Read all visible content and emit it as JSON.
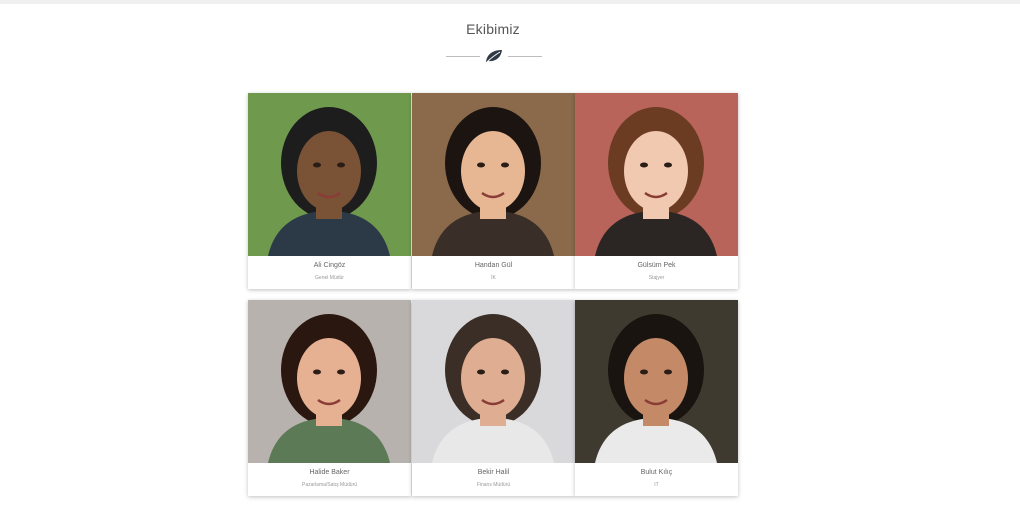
{
  "section": {
    "title": "Ekibimiz"
  },
  "icons": {
    "divider_icon": "leaf-icon"
  },
  "team": [
    {
      "name": "Ali Cingöz",
      "role": "Genel Müdür",
      "bg": "#6f9a4e",
      "skin": "#7a5236",
      "hair": "#1d1d1d",
      "shirt": "#2c3a48"
    },
    {
      "name": "Handan Gül",
      "role": "İK",
      "bg": "#8b6a4b",
      "skin": "#e7b794",
      "hair": "#1c1410",
      "shirt": "#3a2e28"
    },
    {
      "name": "Gülsüm Pek",
      "role": "Stajyer",
      "bg": "#b8645a",
      "skin": "#f1c8b0",
      "hair": "#6b3c22",
      "shirt": "#2b2624"
    },
    {
      "name": "Halide Baker",
      "role": "Pazarlama/Satış Müdürü",
      "bg": "#b7b2ad",
      "skin": "#e6b193",
      "hair": "#2a1710",
      "shirt": "#5c7a56"
    },
    {
      "name": "Bekir Halil",
      "role": "Finans Müdürü",
      "bg": "#d9d9dc",
      "skin": "#dfae92",
      "hair": "#3a2e26",
      "shirt": "#e8e8e8"
    },
    {
      "name": "Bulut Kılıç",
      "role": "IT",
      "bg": "#3f3a30",
      "skin": "#c48a67",
      "hair": "#1a1410",
      "shirt": "#eaeaea"
    }
  ]
}
